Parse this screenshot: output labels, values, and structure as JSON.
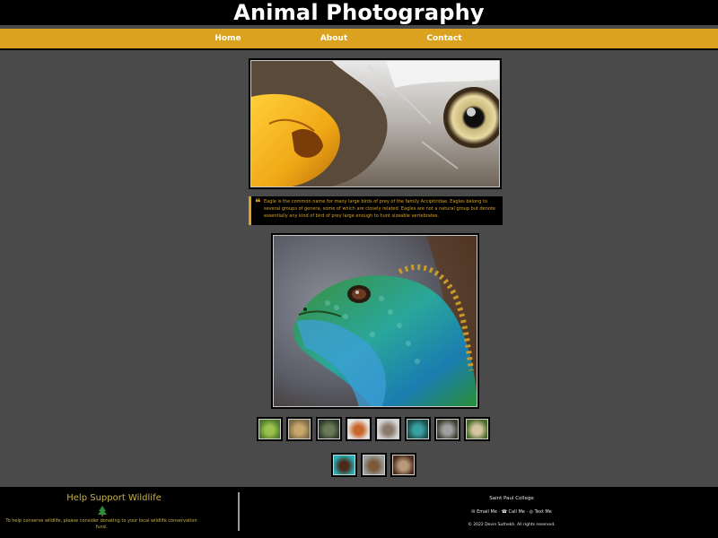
{
  "site": {
    "title": "Animal Photography"
  },
  "nav": {
    "items": [
      {
        "label": "Home"
      },
      {
        "label": "About"
      },
      {
        "label": "Contact"
      }
    ]
  },
  "featured": {
    "eagle_icon": "eagle-photo",
    "quote": "Eagle is the common name for many large birds of prey of the family Accipitridae. Eagles belong to several groups of genera, some of which are closely related. Eagles are not a natural group but denote essentially any kind of bird of prey large enough to hunt sizeable vertebrates.",
    "iguana_icon": "iguana-photo"
  },
  "gallery": {
    "row1": [
      "leaf-thumbnail",
      "lion-thumbnail",
      "deer-thumbnail",
      "fox-thumbnail",
      "hedgehog-thumbnail",
      "lizard-thumbnail",
      "cat-thumbnail",
      "dog-thumbnail"
    ],
    "row2": [
      "turtle-thumbnail",
      "monkey-thumbnail",
      "owl-thumbnail"
    ]
  },
  "footer": {
    "help_title": "Help Support Wildlife",
    "help_text": "To help conserve wildlife, please consider donating to your local wildlife conservation fund.",
    "college": "Saint Paul College",
    "email_label": "Email Me",
    "call_label": "Call Me",
    "text_label": "Text Me",
    "copyright": "© 2022 Devin Suthekh. All rights reserved.",
    "colors": {
      "accent": "#daa21f",
      "footer_text": "#c9b24a"
    }
  }
}
